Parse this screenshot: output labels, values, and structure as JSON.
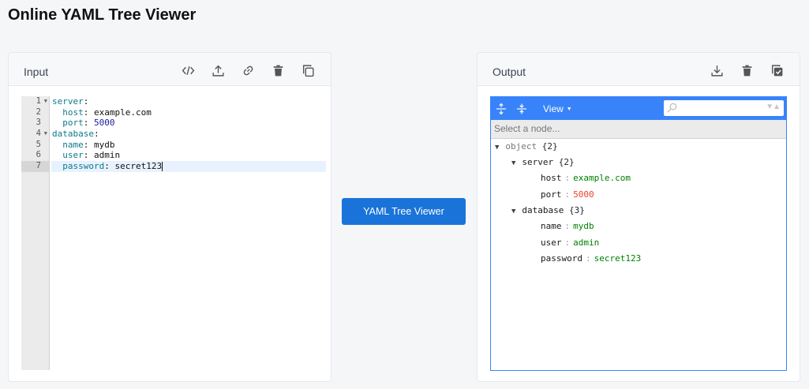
{
  "page_title": "Online YAML Tree Viewer",
  "input": {
    "title": "Input",
    "tools": [
      "code-icon",
      "upload-icon",
      "link-icon",
      "trash-icon",
      "copy-icon"
    ],
    "line_numbers": [
      "1",
      "2",
      "3",
      "4",
      "5",
      "6",
      "7"
    ],
    "lines": [
      {
        "indent": "",
        "key": "server",
        "colon": ":",
        "value": "",
        "value_type": "none"
      },
      {
        "indent": "  ",
        "key": "host",
        "colon": ":",
        "value": " example.com",
        "value_type": "str"
      },
      {
        "indent": "  ",
        "key": "port",
        "colon": ":",
        "value": " 5000",
        "value_type": "num"
      },
      {
        "indent": "",
        "key": "database",
        "colon": ":",
        "value": "",
        "value_type": "none"
      },
      {
        "indent": "  ",
        "key": "name",
        "colon": ":",
        "value": " mydb",
        "value_type": "str"
      },
      {
        "indent": "  ",
        "key": "user",
        "colon": ":",
        "value": " admin",
        "value_type": "str"
      },
      {
        "indent": "  ",
        "key": "password",
        "colon": ":",
        "value": " secret123",
        "value_type": "str"
      }
    ]
  },
  "convert_button": "YAML Tree Viewer",
  "output": {
    "title": "Output",
    "tools": [
      "download-icon",
      "trash-icon",
      "copy-check-icon"
    ],
    "menu": {
      "expand_icon": "expand-all-icon",
      "collapse_icon": "collapse-all-icon",
      "view_label": "View",
      "search_placeholder": ""
    },
    "navbar_text": "Select a node...",
    "tree": {
      "root": {
        "label": "object",
        "count": "{2}"
      },
      "server": {
        "label": "server",
        "count": "{2}"
      },
      "host": {
        "key": "host",
        "value": "example.com"
      },
      "port": {
        "key": "port",
        "value": "5000"
      },
      "database": {
        "label": "database",
        "count": "{3}"
      },
      "name": {
        "key": "name",
        "value": "mydb"
      },
      "user": {
        "key": "user",
        "value": "admin"
      },
      "password": {
        "key": "password",
        "value": "secret123"
      },
      "separator": ":"
    }
  },
  "colors": {
    "accent": "#1a73d9",
    "tree_menu": "#3883fa",
    "string_value": "#008000",
    "number_value": "#ee422e"
  }
}
